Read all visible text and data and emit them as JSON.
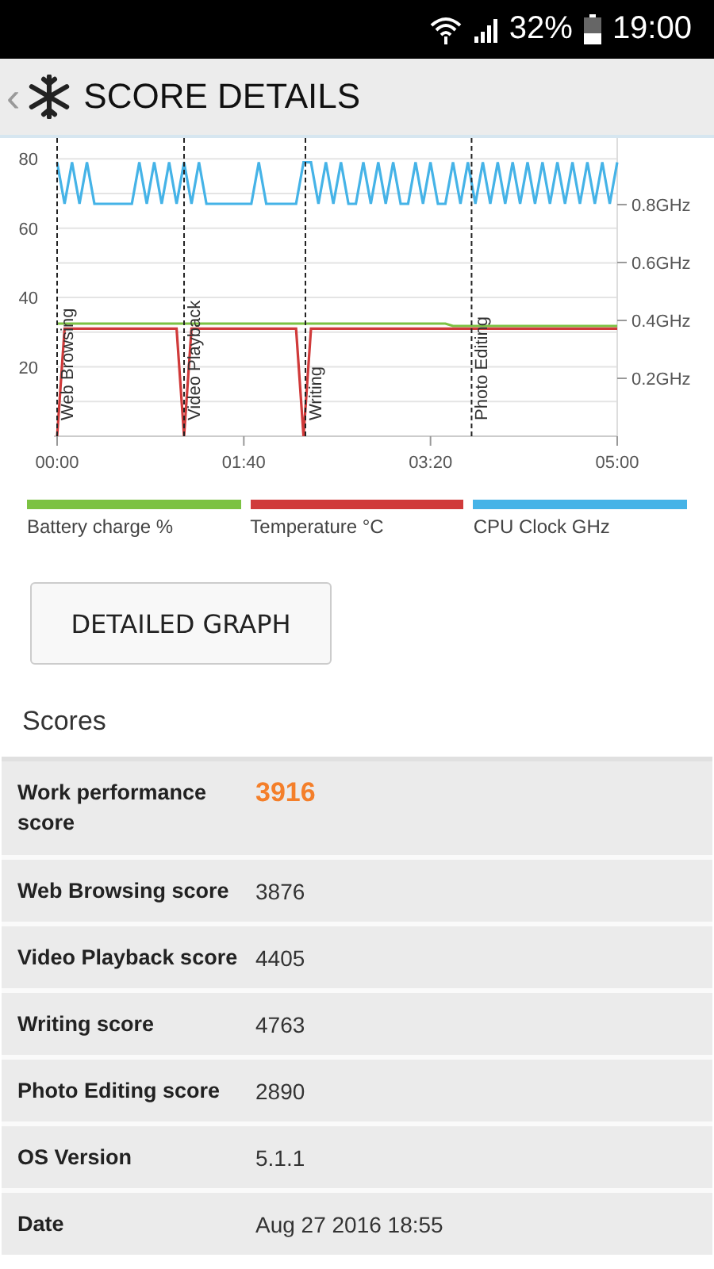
{
  "status_bar": {
    "battery_percent": "32%",
    "time": "19:00"
  },
  "header": {
    "back": "‹",
    "title": "SCORE DETAILS"
  },
  "chart": {
    "right_axis_labels": [
      "0.8GHz",
      "0.6GHz",
      "0.4GHz",
      "0.2GHz"
    ],
    "chart_data": {
      "type": "line",
      "x": [
        0,
        4,
        8,
        12,
        16,
        20,
        24,
        28,
        32,
        36,
        40,
        44,
        48,
        52,
        56,
        60,
        64,
        68,
        72,
        76,
        80,
        84,
        88,
        92,
        96,
        100,
        104,
        108,
        112,
        116,
        120,
        124,
        128,
        132,
        136,
        140,
        144,
        148,
        152,
        156,
        160,
        164,
        168,
        172,
        176,
        180,
        184,
        188,
        192,
        196,
        200,
        204,
        208,
        212,
        216,
        220,
        224,
        228,
        232,
        236,
        240,
        244,
        248,
        252,
        256,
        260,
        264,
        268,
        272,
        276,
        280,
        284,
        288,
        292,
        296,
        300
      ],
      "series": [
        {
          "name": "Battery charge %",
          "color": "#7cc242",
          "values": [
            32.5,
            32.5,
            32.5,
            32.5,
            32.5,
            32.5,
            32.5,
            32.5,
            32.5,
            32.5,
            32.5,
            32.5,
            32.5,
            32.5,
            32.5,
            32.5,
            32.5,
            32.5,
            32.5,
            32.5,
            32.5,
            32.5,
            32.5,
            32.5,
            32.5,
            32.5,
            32.5,
            32.5,
            32.5,
            32.5,
            32.5,
            32.5,
            32.5,
            32.5,
            32.5,
            32.5,
            32.5,
            32.5,
            32.5,
            32.5,
            32.5,
            32.5,
            32.5,
            32.5,
            32.5,
            32.5,
            32.5,
            32.5,
            32.5,
            32.5,
            32.5,
            32.5,
            32.5,
            31.8,
            31.8,
            31.8,
            31.8,
            31.8,
            31.8,
            31.8,
            31.8,
            31.8,
            31.8,
            31.8,
            31.8,
            31.8,
            31.8,
            31.8,
            31.8,
            31.8,
            31.8,
            31.8,
            31.8,
            31.8,
            31.8,
            31.8
          ]
        },
        {
          "name": "Temperature °C",
          "color": "#d03a3a",
          "values": [
            0,
            31,
            31,
            31,
            31,
            31,
            31,
            31,
            31,
            31,
            31,
            31,
            31,
            31,
            31,
            31,
            31,
            0,
            31,
            31,
            31,
            31,
            31,
            31,
            31,
            31,
            31,
            31,
            31,
            31,
            31,
            31,
            31,
            0,
            31,
            31,
            31,
            31,
            31,
            31,
            31,
            31,
            31,
            31,
            31,
            31,
            31,
            31,
            31,
            31,
            31,
            31,
            31,
            31,
            31,
            31,
            31,
            31,
            31,
            31,
            31,
            31,
            31,
            31,
            31,
            31,
            31,
            31,
            31,
            31,
            31,
            31,
            31,
            31,
            31,
            31
          ]
        },
        {
          "name": "CPU Clock GHz",
          "color": "#45b3e7",
          "values": [
            79,
            67,
            79,
            67,
            79,
            67,
            67,
            67,
            67,
            67,
            67,
            79,
            67,
            79,
            67,
            79,
            67,
            79,
            67,
            79,
            67,
            67,
            67,
            67,
            67,
            67,
            67,
            79,
            67,
            67,
            67,
            67,
            67,
            79,
            79,
            67,
            79,
            67,
            79,
            67,
            67,
            79,
            67,
            79,
            67,
            79,
            67,
            67,
            79,
            67,
            79,
            67,
            67,
            79,
            67,
            79,
            67,
            79,
            67,
            79,
            67,
            79,
            67,
            79,
            67,
            79,
            67,
            79,
            67,
            79,
            67,
            79,
            67,
            79,
            67,
            79
          ]
        }
      ],
      "xlim": [
        0,
        300
      ],
      "ylim": [
        0,
        86
      ],
      "grid": true,
      "xticks": [
        {
          "value": 0,
          "label": "00:00"
        },
        {
          "value": 100,
          "label": "01:40"
        },
        {
          "value": 200,
          "label": "03:20"
        },
        {
          "value": 300,
          "label": "05:00"
        }
      ],
      "yticks": [
        20,
        40,
        60,
        80
      ],
      "ref_lines": [
        {
          "axis": "x",
          "value": 0,
          "label": "Web Browsing"
        },
        {
          "axis": "x",
          "value": 68,
          "label": "Video Playback"
        },
        {
          "axis": "x",
          "value": 133,
          "label": "Writing"
        },
        {
          "axis": "x",
          "value": 222,
          "label": "Photo Editing"
        }
      ]
    }
  },
  "detail_button": "DETAILED GRAPH",
  "scores": {
    "title": "Scores",
    "rows": [
      {
        "kind": "main",
        "label": "Work performance score",
        "value": "3916"
      },
      {
        "kind": "plain",
        "label": "Web Browsing score",
        "value": "3876"
      },
      {
        "kind": "plain",
        "label": "Video Playback score",
        "value": "4405"
      },
      {
        "kind": "plain",
        "label": "Writing score",
        "value": "4763"
      },
      {
        "kind": "plain",
        "label": "Photo Editing score",
        "value": "2890"
      },
      {
        "kind": "plain",
        "label": "OS Version",
        "value": "5.1.1"
      },
      {
        "kind": "plain",
        "label": "Date",
        "value": "Aug 27 2016 18:55"
      }
    ]
  }
}
